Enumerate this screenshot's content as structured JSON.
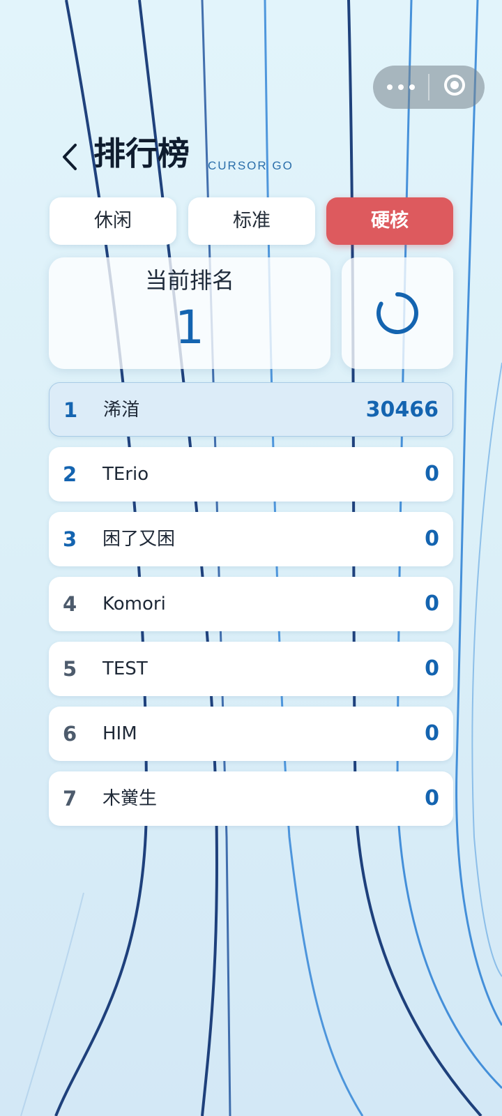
{
  "colors": {
    "accent": "#1464b0",
    "active_tab": "#dd5a5e",
    "line_dark": "#0a2d6e",
    "line_blue": "#2a7fd4"
  },
  "header": {
    "title": "排行榜",
    "subtitle": "CURSOR GO",
    "back_icon": "chevron-left-icon"
  },
  "capsule": {
    "more_icon": "more-dots-icon",
    "close_icon": "target-circle-icon"
  },
  "tabs": [
    {
      "label": "休闲",
      "active": false
    },
    {
      "label": "标准",
      "active": false
    },
    {
      "label": "硬核",
      "active": true
    }
  ],
  "current_rank": {
    "label": "当前排名",
    "value": "1"
  },
  "refresh": {
    "icon": "refresh-spinner-icon"
  },
  "leaderboard": [
    {
      "rank": "1",
      "name": "浠渞",
      "score": "30466"
    },
    {
      "rank": "2",
      "name": "TErio",
      "score": "0"
    },
    {
      "rank": "3",
      "name": "困了又困",
      "score": "0"
    },
    {
      "rank": "4",
      "name": "Komori",
      "score": "0"
    },
    {
      "rank": "5",
      "name": "TEST",
      "score": "0"
    },
    {
      "rank": "6",
      "name": "HIM",
      "score": "0"
    },
    {
      "rank": "7",
      "name": "木黉生",
      "score": "0"
    }
  ]
}
